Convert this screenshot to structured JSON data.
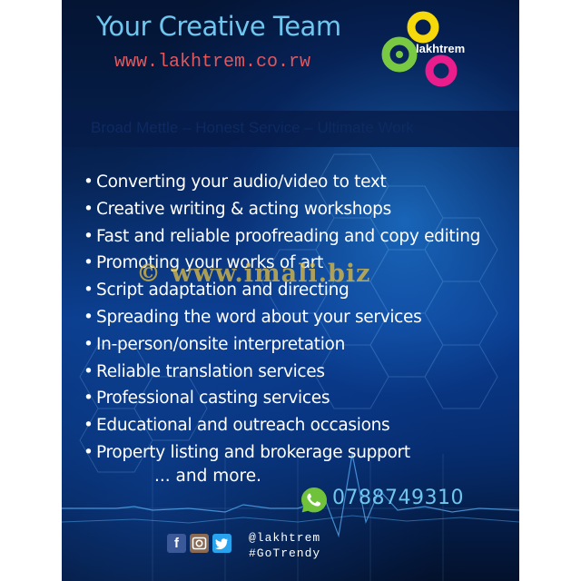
{
  "header": {
    "title": "Your Creative Team",
    "url": "www.lakhtrem.co.rw",
    "logo_text": "lakhtrem",
    "logo_colors": [
      "#f5d90a",
      "#e91e8c",
      "#7ac943"
    ]
  },
  "tagline": "Broad Mettle – Honest Service – Ultimate Work",
  "services": {
    "bullet": "•",
    "items": [
      "Converting your audio/video to text",
      "Creative writing & acting workshops",
      "Fast and reliable proofreading and copy editing",
      "Promoting your works of art",
      "Script adaptation and directing",
      "Spreading the word about your services",
      "In-person/onsite interpretation",
      "Reliable translation services",
      "Professional casting services",
      "Educational and outreach occasions",
      "Property listing and brokerage support"
    ],
    "more": "... and more."
  },
  "contact": {
    "phone": "0788749310",
    "phone_icon": "whatsapp-phone-icon",
    "handle": "@lakhtrem",
    "hashtag": "#GoTrendy",
    "social_icons": [
      "facebook-icon",
      "instagram-icon",
      "twitter-icon"
    ]
  },
  "watermark": "© www.imali.biz",
  "colors": {
    "title": "#6fc6ee",
    "url": "#e0585e",
    "background": "#06214f",
    "watermark": "#dabb46"
  }
}
